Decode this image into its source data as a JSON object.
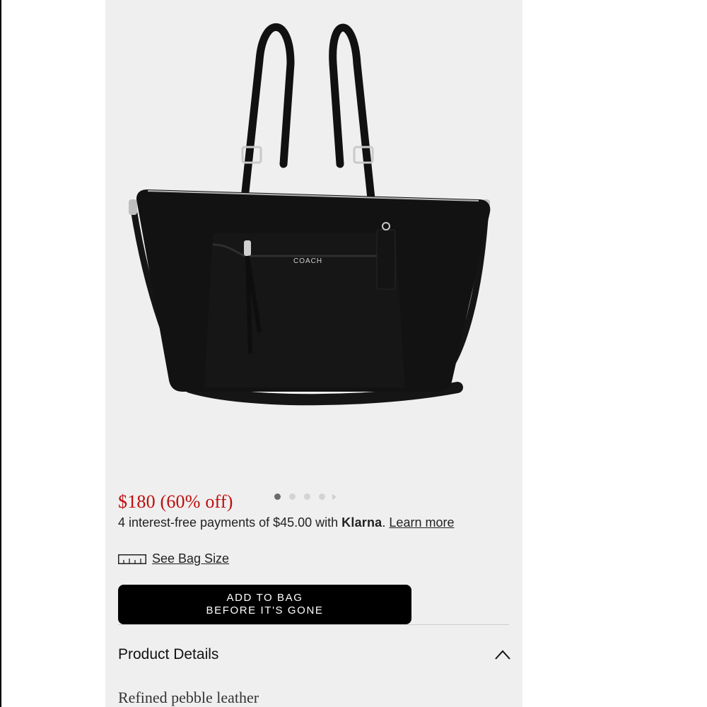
{
  "product": {
    "image_alt": "black pebble leather tote bag with silver hardware and crossbody strap",
    "price": "$180 (60% off)",
    "colors": {
      "price": "#c00d0d",
      "button_bg": "#000000",
      "panel_bg": "#efefef"
    }
  },
  "carousel": {
    "dot_count": 4,
    "active_index": 0
  },
  "klarna": {
    "prefix": "4 interest-free payments of $45.00 with ",
    "brand": "Klarna",
    "suffix": ". ",
    "learn_more": "Learn more"
  },
  "bag_size": {
    "icon": "ruler-icon",
    "label": "See Bag Size"
  },
  "add_to_bag": {
    "line1": "ADD TO BAG",
    "line2": "BEFORE IT'S GONE"
  },
  "details": {
    "title": "Product Details",
    "icon": "chevron-up-icon",
    "first_line": "Refined pebble leather"
  }
}
